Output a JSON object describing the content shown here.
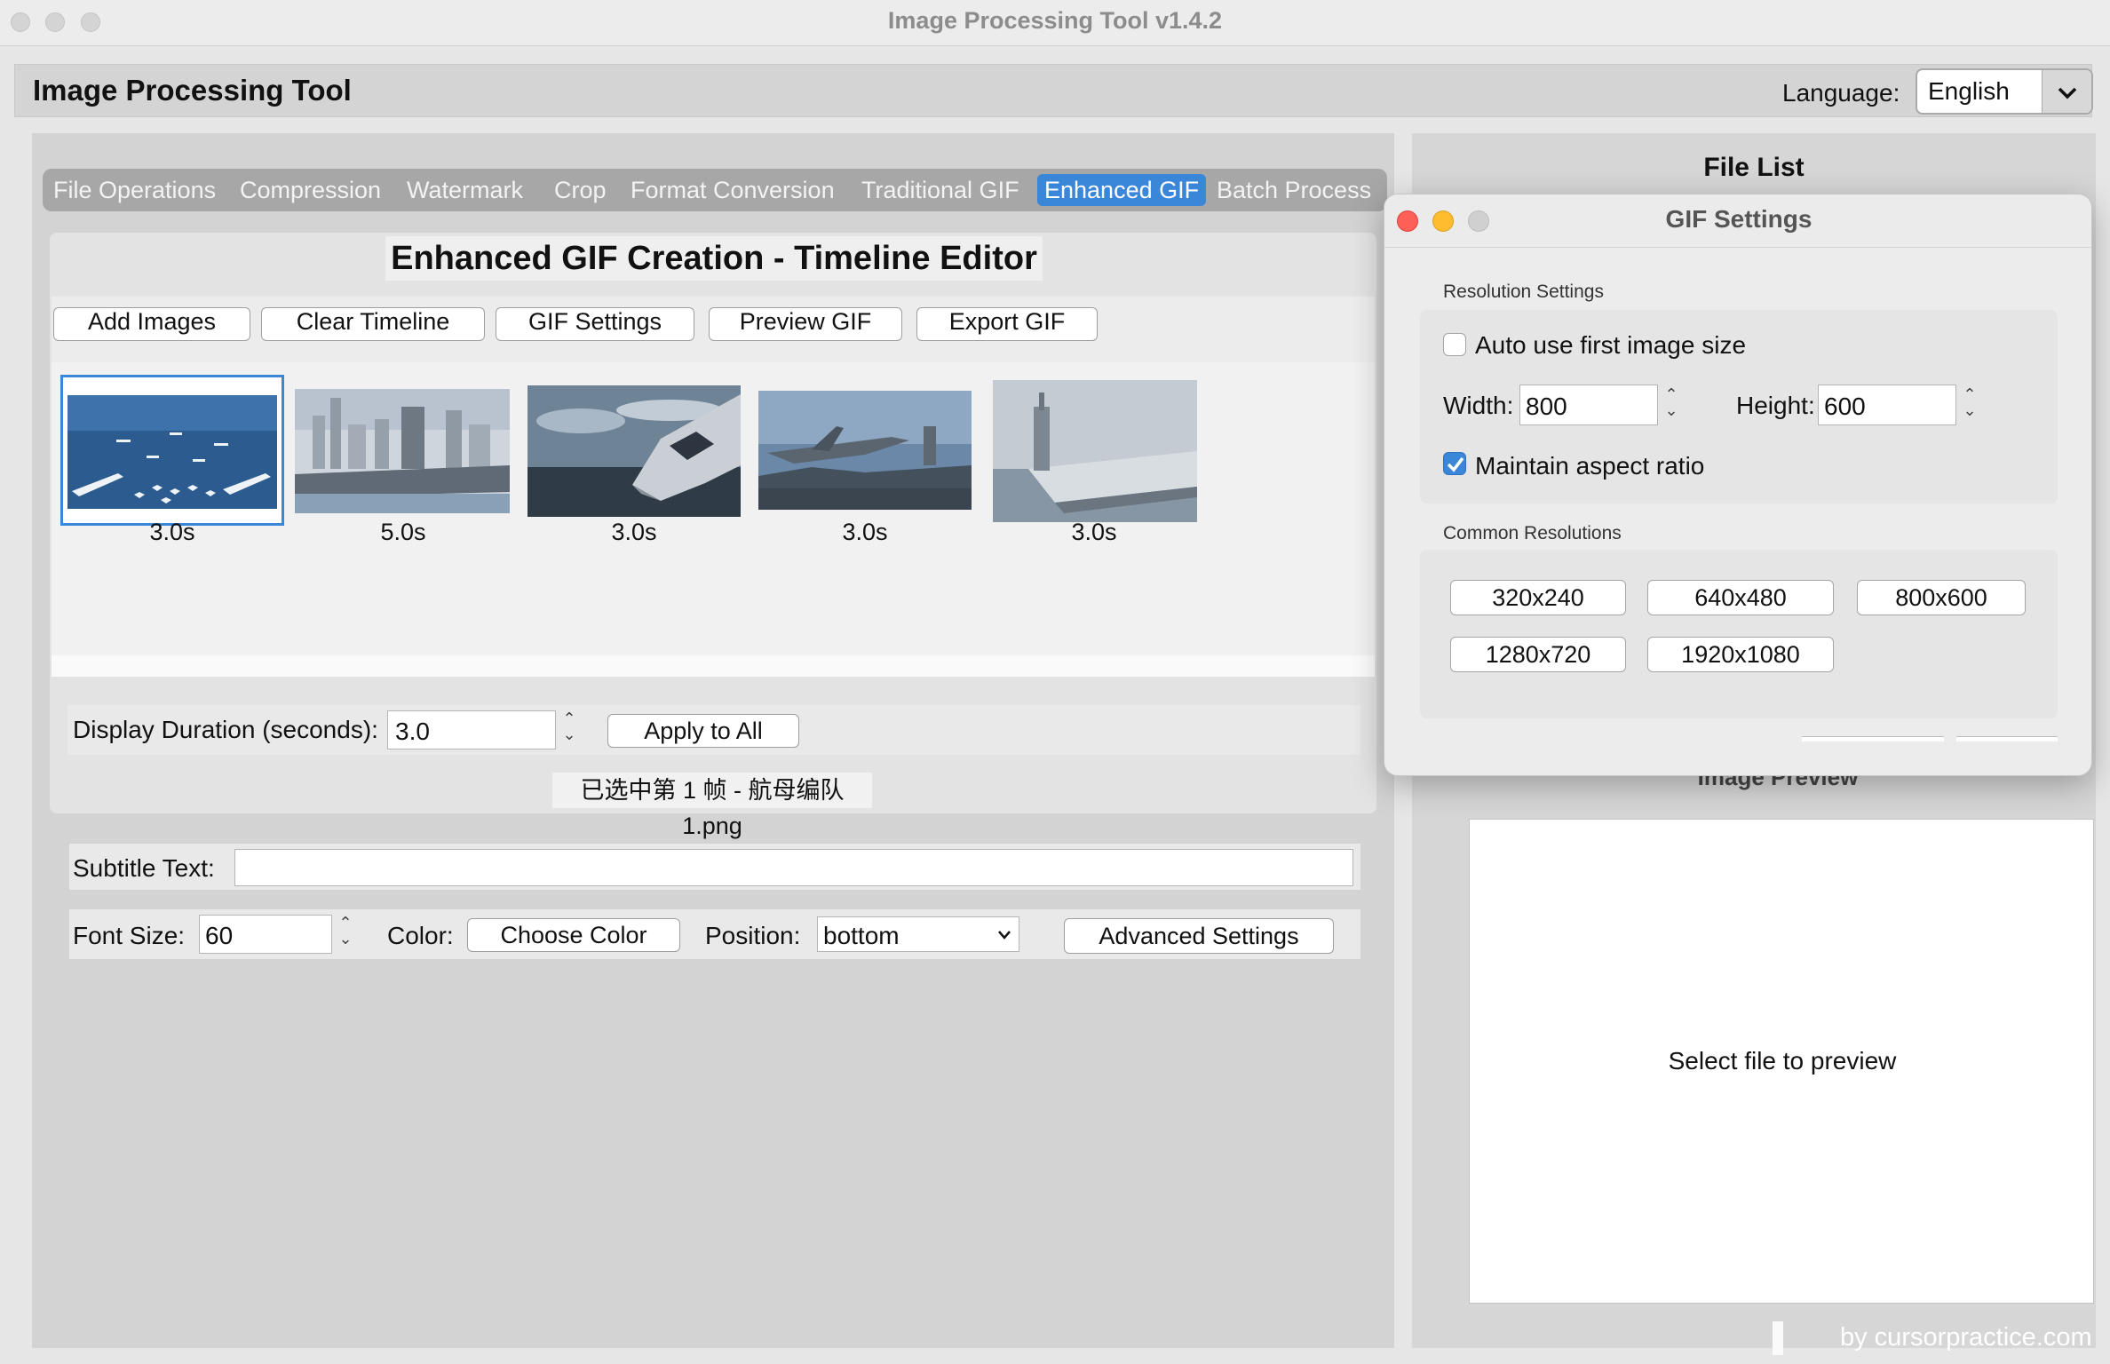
{
  "window": {
    "title": "Image Processing Tool v1.4.2"
  },
  "header": {
    "app_title": "Image Processing Tool",
    "language_label": "Language:",
    "language_value": "English"
  },
  "tabs": [
    {
      "label": "File Operations"
    },
    {
      "label": "Compression"
    },
    {
      "label": "Watermark"
    },
    {
      "label": "Crop"
    },
    {
      "label": "Format Conversion"
    },
    {
      "label": "Traditional GIF"
    },
    {
      "label": "Enhanced GIF",
      "active": true
    },
    {
      "label": "Batch Process"
    }
  ],
  "editor": {
    "title": "Enhanced GIF Creation - Timeline Editor",
    "toolbar": {
      "add_images": "Add Images",
      "clear_timeline": "Clear Timeline",
      "gif_settings": "GIF Settings",
      "preview_gif": "Preview GIF",
      "export_gif": "Export GIF"
    },
    "frames": [
      {
        "duration": "3.0s",
        "thumbnail": "carrier-fleet-formation",
        "selected": true
      },
      {
        "duration": "5.0s",
        "thumbnail": "carrier-in-harbor-city"
      },
      {
        "duration": "3.0s",
        "thumbnail": "fighter-jet-closeup"
      },
      {
        "duration": "3.0s",
        "thumbnail": "jet-on-carrier-deck"
      },
      {
        "duration": "3.0s",
        "thumbnail": "carrier-at-sea"
      }
    ],
    "duration": {
      "label": "Display Duration (seconds):",
      "value": "3.0",
      "apply_all": "Apply to All"
    },
    "selection_info": "已选中第 1 帧 - 航母编队1.png",
    "subtitle": {
      "label": "Subtitle Text:",
      "value": ""
    },
    "font": {
      "size_label": "Font Size:",
      "size_value": "60",
      "color_label": "Color:",
      "choose_color": "Choose Color",
      "position_label": "Position:",
      "position_value": "bottom",
      "advanced": "Advanced Settings"
    }
  },
  "right_panel": {
    "file_list_title": "File List",
    "image_preview_title": "Image Preview",
    "preview_placeholder": "Select file to preview",
    "watermark": "by cursorpractice.com"
  },
  "gif_dialog": {
    "title": "GIF Settings",
    "resolution_group": "Resolution Settings",
    "auto_size_label": "Auto use first image size",
    "auto_size_checked": false,
    "width_label": "Width:",
    "width_value": "800",
    "height_label": "Height:",
    "height_value": "600",
    "aspect_label": "Maintain aspect ratio",
    "aspect_checked": true,
    "common_group": "Common Resolutions",
    "resolutions": [
      "320x240",
      "640x480",
      "800x600",
      "1280x720",
      "1920x1080"
    ]
  },
  "colors": {
    "accent": "#3a86d8",
    "close": "#fe5f57",
    "minimize": "#febc2e",
    "tab_bar": "#a7a7a7"
  },
  "icons": [
    "chevron-down-icon",
    "spinner-arrows-icon",
    "checkmark-icon"
  ]
}
